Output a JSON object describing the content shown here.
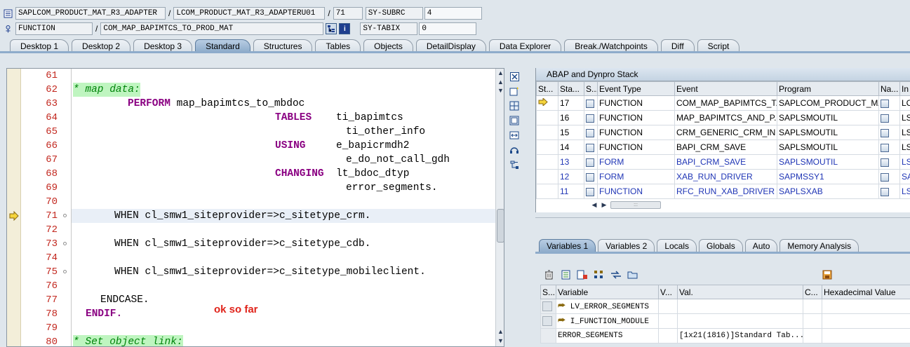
{
  "header": {
    "program": "SAPLCOM_PRODUCT_MAT_R3_ADAPTER",
    "include": "LCOM_PRODUCT_MAT_R3_ADAPTERU01",
    "line": "71",
    "kind": "FUNCTION",
    "name": "COM_MAP_BAPIMTCS_TO_PROD_MAT",
    "sys1_label": "SY-SUBRC",
    "sys1_value": "4",
    "sys2_label": "SY-TABIX",
    "sys2_value": "0",
    "sep": "/"
  },
  "tabs": [
    "Desktop 1",
    "Desktop 2",
    "Desktop 3",
    "Standard",
    "Structures",
    "Tables",
    "Objects",
    "DetailDisplay",
    "Data Explorer",
    "Break./Watchpoints",
    "Diff",
    "Script"
  ],
  "active_tab": "Standard",
  "editor": {
    "note": "ok so far",
    "lines": [
      {
        "n": "61"
      },
      {
        "n": "62"
      },
      {
        "n": "63"
      },
      {
        "n": "64"
      },
      {
        "n": "65"
      },
      {
        "n": "66"
      },
      {
        "n": "67"
      },
      {
        "n": "68"
      },
      {
        "n": "69"
      },
      {
        "n": "70"
      },
      {
        "n": "71"
      },
      {
        "n": "72"
      },
      {
        "n": "73"
      },
      {
        "n": "74"
      },
      {
        "n": "75"
      },
      {
        "n": "76"
      },
      {
        "n": "77"
      },
      {
        "n": "78"
      },
      {
        "n": "79"
      },
      {
        "n": "80"
      }
    ],
    "code": {
      "l62": "* map data:",
      "l63_kw": "PERFORM",
      "l63_rest": " map_bapimtcs_to_mbdoc",
      "l64_kw": "TABLES",
      "l64_rest": "    ti_bapimtcs",
      "l65": "ti_other_info",
      "l66_kw": "USING",
      "l66_rest": "     e_bapicrmdh2",
      "l67": "e_do_not_call_gdh",
      "l68_kw": "CHANGING",
      "l68_rest": "  lt_bdoc_dtyp",
      "l69": "error_segments.",
      "l71": "WHEN cl_smw1_siteprovider=>c_sitetype_crm.",
      "l73": "WHEN cl_smw1_siteprovider=>c_sitetype_cdb.",
      "l75": "WHEN cl_smw1_siteprovider=>c_sitetype_mobileclient.",
      "l77": "ENDCASE.",
      "l78": "ENDIF.",
      "l80": "* Set object link:"
    }
  },
  "stack": {
    "title": "ABAP and Dynpro Stack",
    "columns": [
      "St...",
      "Sta...",
      "S...",
      "Event Type",
      "Event",
      "Program",
      "Na...",
      "In"
    ],
    "rows": [
      {
        "level": "17",
        "type": "FUNCTION",
        "event": "COM_MAP_BAPIMTCS_T...",
        "program": "SAPLCOM_PRODUCT_MA...",
        "inc": "LC",
        "current": true,
        "blue": false
      },
      {
        "level": "16",
        "type": "FUNCTION",
        "event": "MAP_BAPIMTCS_AND_P...",
        "program": "SAPLSMOUTIL",
        "inc": "LS",
        "current": false,
        "blue": false
      },
      {
        "level": "15",
        "type": "FUNCTION",
        "event": "CRM_GENERIC_CRM_IN",
        "program": "SAPLSMOUTIL",
        "inc": "LS",
        "current": false,
        "blue": false
      },
      {
        "level": "14",
        "type": "FUNCTION",
        "event": "BAPI_CRM_SAVE",
        "program": "SAPLSMOUTIL",
        "inc": "LS",
        "current": false,
        "blue": false
      },
      {
        "level": "13",
        "type": "FORM",
        "event": "BAPI_CRM_SAVE",
        "program": "SAPLSMOUTIL",
        "inc": "LS",
        "current": false,
        "blue": true
      },
      {
        "level": "12",
        "type": "FORM",
        "event": "XAB_RUN_DRIVER",
        "program": "SAPMSSY1",
        "inc": "SA",
        "current": false,
        "blue": true
      },
      {
        "level": "11",
        "type": "FUNCTION",
        "event": "RFC_RUN_XAB_DRIVER",
        "program": "SAPLSXAB",
        "inc": "LS",
        "current": false,
        "blue": true
      }
    ]
  },
  "vtabs": [
    "Variables 1",
    "Variables 2",
    "Locals",
    "Globals",
    "Auto",
    "Memory Analysis"
  ],
  "vars": {
    "columns": [
      "S...",
      "Variable",
      "V...",
      "Val.",
      "C...",
      "Hexadecimal Value"
    ],
    "rows": [
      {
        "name": "LV_ERROR_SEGMENTS",
        "value": "",
        "icon": true
      },
      {
        "name": "I_FUNCTION_MODULE",
        "value": "",
        "icon": true
      },
      {
        "name": "ERROR_SEGMENTS",
        "value": "[1x21(1816)]Standard Tab...",
        "icon": false
      }
    ]
  },
  "colors": {
    "keyword": "#8a0082",
    "comment": "#00840a",
    "line_number": "#c2271e",
    "note": "#e0241b",
    "blue_row": "#1f35b5"
  },
  "icons": [
    "source-icon",
    "function-icon",
    "hierarchy-icon",
    "info-icon",
    "close-icon",
    "new-icon",
    "arrow-icon",
    "save-icon"
  ]
}
